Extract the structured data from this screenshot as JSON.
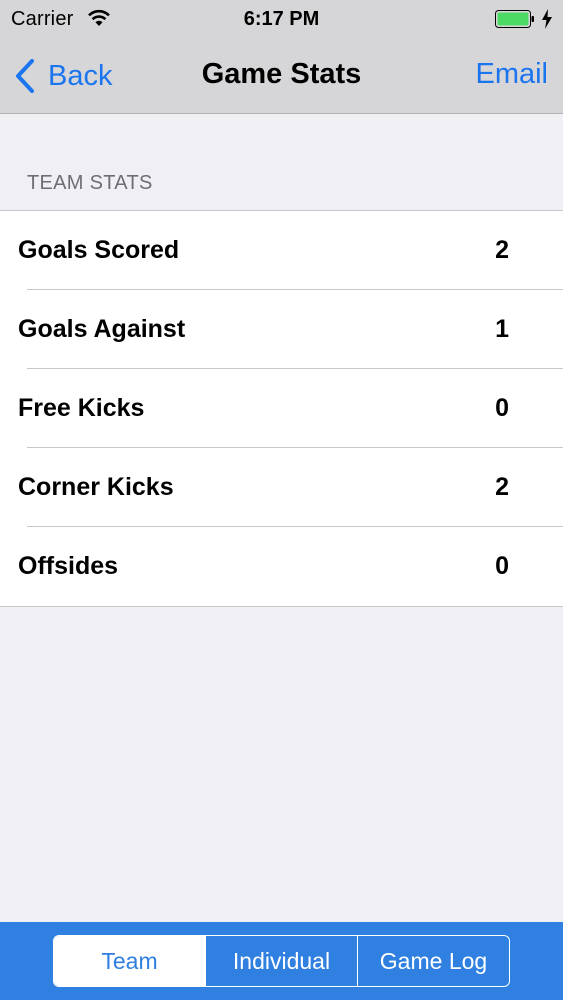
{
  "status_bar": {
    "carrier": "Carrier",
    "time": "6:17 PM",
    "battery_color": "#4cd964"
  },
  "nav": {
    "back_label": "Back",
    "title": "Game Stats",
    "email_label": "Email",
    "accent_color": "#1a75ef"
  },
  "section": {
    "header": "TEAM STATS"
  },
  "stats": [
    {
      "label": "Goals Scored",
      "value": "2"
    },
    {
      "label": "Goals Against",
      "value": "1"
    },
    {
      "label": "Free Kicks",
      "value": "0"
    },
    {
      "label": "Corner Kicks",
      "value": "2"
    },
    {
      "label": "Offsides",
      "value": "0"
    }
  ],
  "tabs": {
    "items": [
      {
        "label": "Team",
        "selected": true
      },
      {
        "label": "Individual",
        "selected": false
      },
      {
        "label": "Game Log",
        "selected": false
      }
    ],
    "bar_color": "#2f80e0"
  }
}
